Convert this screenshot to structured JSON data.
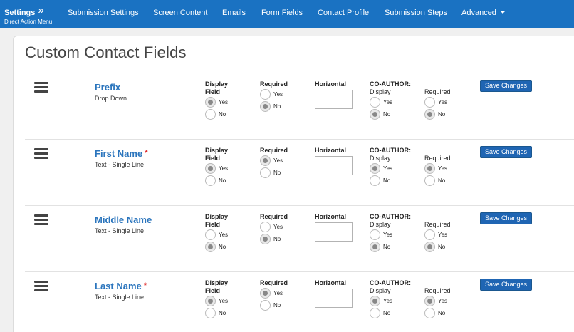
{
  "nav": {
    "brand_title": "Settings",
    "brand_chevron": "»",
    "brand_sub": "Direct Action Menu",
    "items": [
      {
        "label": "Submission Settings"
      },
      {
        "label": "Screen Content"
      },
      {
        "label": "Emails"
      },
      {
        "label": "Form Fields"
      },
      {
        "label": "Contact Profile"
      },
      {
        "label": "Submission Steps"
      },
      {
        "label": "Advanced"
      }
    ]
  },
  "page": {
    "title": "Custom Contact Fields"
  },
  "labels": {
    "display_field_1": "Display",
    "display_field_2": "Field",
    "required": "Required",
    "horizontal": "Horizontal",
    "coauthor": "CO-AUTHOR:",
    "coauthor_display": "Display",
    "coauthor_required": "Required",
    "yes": "Yes",
    "no": "No",
    "save": "Save Changes",
    "required_star": "*"
  },
  "fields": [
    {
      "name": "Prefix",
      "type": "Drop Down",
      "required_mark": false,
      "display": "yes",
      "required": "no",
      "horizontal": "",
      "co_display": "no",
      "co_required": "no"
    },
    {
      "name": "First Name",
      "type": "Text - Single Line",
      "required_mark": true,
      "display": "yes",
      "required": "yes",
      "horizontal": "",
      "co_display": "yes",
      "co_required": "yes"
    },
    {
      "name": "Middle Name",
      "type": "Text - Single Line",
      "required_mark": false,
      "display": "no",
      "required": "no",
      "horizontal": "",
      "co_display": "no",
      "co_required": "no"
    },
    {
      "name": "Last Name",
      "type": "Text - Single Line",
      "required_mark": true,
      "display": "yes",
      "required": "yes",
      "horizontal": "",
      "co_display": "yes",
      "co_required": "yes"
    }
  ],
  "colors": {
    "nav_bg": "#1a72c2",
    "field_name": "#2b75bd",
    "button_bg": "#1f65b3",
    "required_star": "#e02b2b"
  },
  "icons": {
    "drag": "drag-handle-icon",
    "nav_chevron": "double-chevron-right-icon",
    "dropdown": "caret-down-icon"
  }
}
